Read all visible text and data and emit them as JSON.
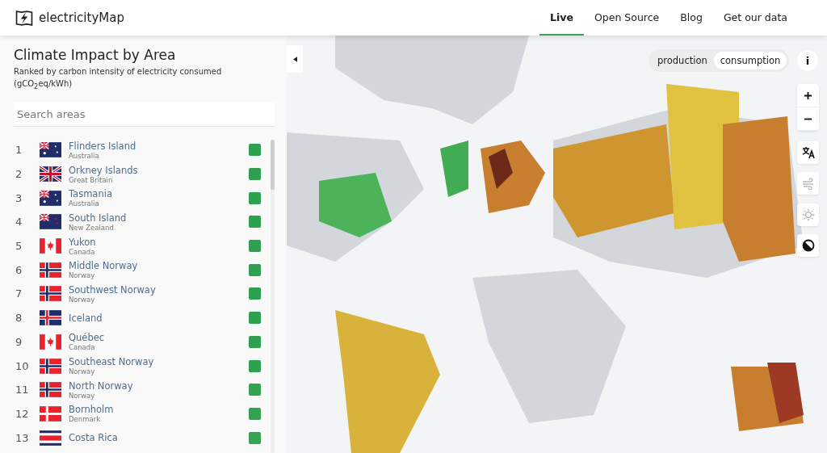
{
  "header": {
    "logo_text": "electricityMap",
    "nav": [
      {
        "label": "Live",
        "selected": true
      },
      {
        "label": "Open Source",
        "selected": false
      },
      {
        "label": "Blog",
        "selected": false
      },
      {
        "label": "Get our data",
        "selected": false
      }
    ]
  },
  "panel": {
    "title": "Climate Impact by Area",
    "subtitle": "Ranked by carbon intensity of electricity consumed (gCO$_{2}$eq/kWh)",
    "search": {
      "placeholder": "Search areas"
    },
    "areas": [
      {
        "rank": "1",
        "name": "Flinders Island",
        "country": "Australia",
        "kind": "australia",
        "color": "#2fa050"
      },
      {
        "rank": "2",
        "name": "Orkney Islands",
        "country": "Great Britain",
        "kind": "britain",
        "color": "#2fa050"
      },
      {
        "rank": "3",
        "name": "Tasmania",
        "country": "Australia",
        "kind": "australia",
        "color": "#2fa050"
      },
      {
        "rank": "4",
        "name": "South Island",
        "country": "New Zealand",
        "kind": "newzealand",
        "color": "#2fa050"
      },
      {
        "rank": "5",
        "name": "Yukon",
        "country": "Canada",
        "kind": "canada",
        "color": "#2fa050"
      },
      {
        "rank": "6",
        "name": "Middle Norway",
        "country": "Norway",
        "kind": "norway",
        "color": "#2fa050"
      },
      {
        "rank": "7",
        "name": "Southwest Norway",
        "country": "Norway",
        "kind": "norway",
        "color": "#2fa050"
      },
      {
        "rank": "8",
        "name": "Iceland",
        "kind": "iceland",
        "color": "#2fa050"
      },
      {
        "rank": "9",
        "name": "Québec",
        "country": "Canada",
        "kind": "canada",
        "color": "#2fa050"
      },
      {
        "rank": "10",
        "name": "Southeast Norway",
        "country": "Norway",
        "kind": "norway",
        "color": "#2fa050"
      },
      {
        "rank": "11",
        "name": "North Norway",
        "country": "Norway",
        "kind": "norway",
        "color": "#33a352"
      },
      {
        "rank": "12",
        "name": "Bornholm",
        "country": "Denmark",
        "kind": "denmark",
        "color": "#33a352"
      },
      {
        "rank": "13",
        "name": "Costa Rica",
        "kind": "costarica",
        "color": "#35a553"
      }
    ]
  },
  "map": {
    "mode_toggle": [
      {
        "label": "production",
        "selected": false
      },
      {
        "label": "consumption",
        "selected": true
      }
    ],
    "info_button": "i"
  }
}
